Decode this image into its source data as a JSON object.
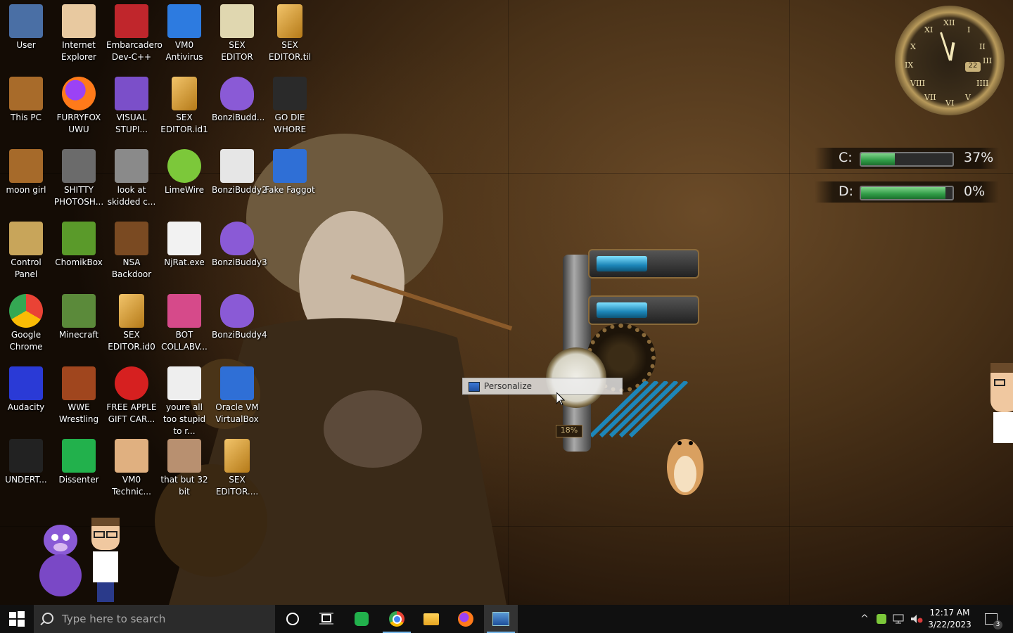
{
  "desktop_icons": [
    {
      "label": "User",
      "icon": "user-folder-icon",
      "color": "#4a6fa5"
    },
    {
      "label": "Internet Explorer",
      "icon": "hank-hill-icon",
      "color": "#e8c9a0"
    },
    {
      "label": "Embarcadero Dev-C++",
      "icon": "devcpp-icon",
      "color": "#c0262c"
    },
    {
      "label": "VM0 Antivirus",
      "icon": "shield-icon",
      "color": "#2d7be0"
    },
    {
      "label": "SEX EDITOR",
      "icon": "hxd-icon",
      "color": "#e0d7b0"
    },
    {
      "label": "SEX EDITOR.til",
      "icon": "file-icon",
      "color": "#d99a2b"
    },
    {
      "label": "This PC",
      "icon": "computer-icon",
      "color": "#a86b2a"
    },
    {
      "label": "FURRYFOX UWU",
      "icon": "firefox-icon",
      "color": "#ff7a1a"
    },
    {
      "label": "VISUAL STUPI...",
      "icon": "visual-studio-icon",
      "color": "#7b4fc9"
    },
    {
      "label": "SEX EDITOR.id1",
      "icon": "file-icon",
      "color": "#d99a2b"
    },
    {
      "label": "BonziBudd...",
      "icon": "bonzibuddy-icon",
      "color": "#8a5ad6"
    },
    {
      "label": "GO DIE WHORE",
      "icon": "dreamweaver-icon",
      "color": "#2a2a2a"
    },
    {
      "label": "moon girl",
      "icon": "box-icon",
      "color": "#a66a2a"
    },
    {
      "label": "SHITTY PHOTOSH...",
      "icon": "gimp-icon",
      "color": "#6b6b6b"
    },
    {
      "label": "look at skidded c...",
      "icon": "stack-icon",
      "color": "#8a8a8a"
    },
    {
      "label": "LimeWire",
      "icon": "limewire-icon",
      "color": "#7cc83a"
    },
    {
      "label": "BonziBuddy2",
      "icon": "folder-icon",
      "color": "#e6e6e6"
    },
    {
      "label": "Fake Faggot",
      "icon": "virtualbox-cube-icon",
      "color": "#2f6fd6"
    },
    {
      "label": "Control Panel",
      "icon": "lightbulb-icon",
      "color": "#c8a55a"
    },
    {
      "label": "ChomikBox",
      "icon": "hamster-box-icon",
      "color": "#5a9a2a"
    },
    {
      "label": "NSA Backdoor",
      "icon": "box-icon",
      "color": "#7a4a22"
    },
    {
      "label": "NjRat.exe",
      "icon": "skull-icon",
      "color": "#f2f2f2"
    },
    {
      "label": "BonziBuddy3",
      "icon": "bonzibuddy-icon",
      "color": "#8a5ad6"
    },
    {
      "label": "Google Chrome",
      "icon": "chrome-icon",
      "color": "#1aa260"
    },
    {
      "label": "Minecraft",
      "icon": "minecraft-icon",
      "color": "#5b8a3a"
    },
    {
      "label": "SEX EDITOR.id0",
      "icon": "file-icon",
      "color": "#d99a2b"
    },
    {
      "label": "BOT COLLABV...",
      "icon": "image-icon",
      "color": "#d64a8a"
    },
    {
      "label": "BonziBuddy4",
      "icon": "bonzibuddy-icon",
      "color": "#8a5ad6"
    },
    {
      "label": "Audacity",
      "icon": "audacity-icon",
      "color": "#2a3ad6"
    },
    {
      "label": "WWE Wrestling",
      "icon": "box-icon",
      "color": "#a0461e"
    },
    {
      "label": "FREE APPLE GIFT CAR...",
      "icon": "apple-icon",
      "color": "#d62020"
    },
    {
      "label": "youre all too stupid to r...",
      "icon": "portrait-icon",
      "color": "#eeeeee"
    },
    {
      "label": "Oracle VM VirtualBox",
      "icon": "virtualbox-cube-icon",
      "color": "#2f6fd6"
    },
    {
      "label": "UNDERT...",
      "icon": "unity-icon",
      "color": "#222222"
    },
    {
      "label": "Dissenter",
      "icon": "dissenter-icon",
      "color": "#22b14c"
    },
    {
      "label": "VM0 Technic...",
      "icon": "doctor-icon",
      "color": "#e0b080"
    },
    {
      "label": "that but 32 bit",
      "icon": "painting-icon",
      "color": "#b89070"
    },
    {
      "label": "SEX EDITOR....",
      "icon": "file-icon",
      "color": "#d99a2b"
    }
  ],
  "clock_widget": {
    "numerals": [
      "XII",
      "I",
      "II",
      "III",
      "IIII",
      "V",
      "VI",
      "VII",
      "VIII",
      "IX",
      "X",
      "XI"
    ],
    "date": "22"
  },
  "drives": [
    {
      "letter": "C:",
      "percent_text": "37%",
      "fill": 0.37
    },
    {
      "letter": "D:",
      "percent_text": "0%",
      "fill": 0.92
    }
  ],
  "gadget": {
    "percent_text": "18%",
    "tube1_fill": 0.55,
    "tube2_fill": 0.55
  },
  "tooltip": {
    "label": "Personalize"
  },
  "taskbar": {
    "search_placeholder": "Type here to search",
    "time": "12:17 AM",
    "date": "3/22/2023",
    "notification_count": "3"
  }
}
